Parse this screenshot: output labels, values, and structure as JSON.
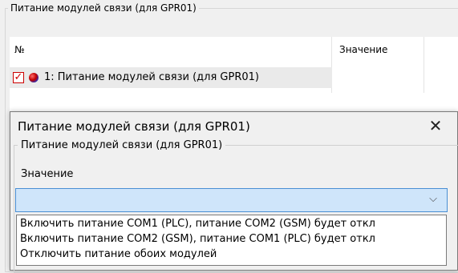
{
  "background": {
    "group_title": "Питание модулей связи (для GPR01)",
    "table": {
      "columns": [
        "№",
        "Значение"
      ],
      "rows": [
        {
          "checked": true,
          "label": "1: Питание модулей связи (для GPR01)"
        }
      ]
    }
  },
  "dialog": {
    "title": "Питание модулей связи (для GPR01)",
    "close_glyph": "✕",
    "group_title": "Питание модулей связи (для GPR01)",
    "value_label": "Значение",
    "combo_value": "",
    "combo_arrow": "⌵",
    "options": [
      "Включить питание COM1 (PLC), питание COM2 (GSM) будет откл",
      "Включить питание COM2 (GSM), питание COM1 (PLC) будет откл",
      "Отключить питание обоих модулей"
    ]
  },
  "colors": {
    "combo_fill": "#cfe5fa",
    "combo_border": "#4a8fd4",
    "check_red": "#cc0000"
  }
}
